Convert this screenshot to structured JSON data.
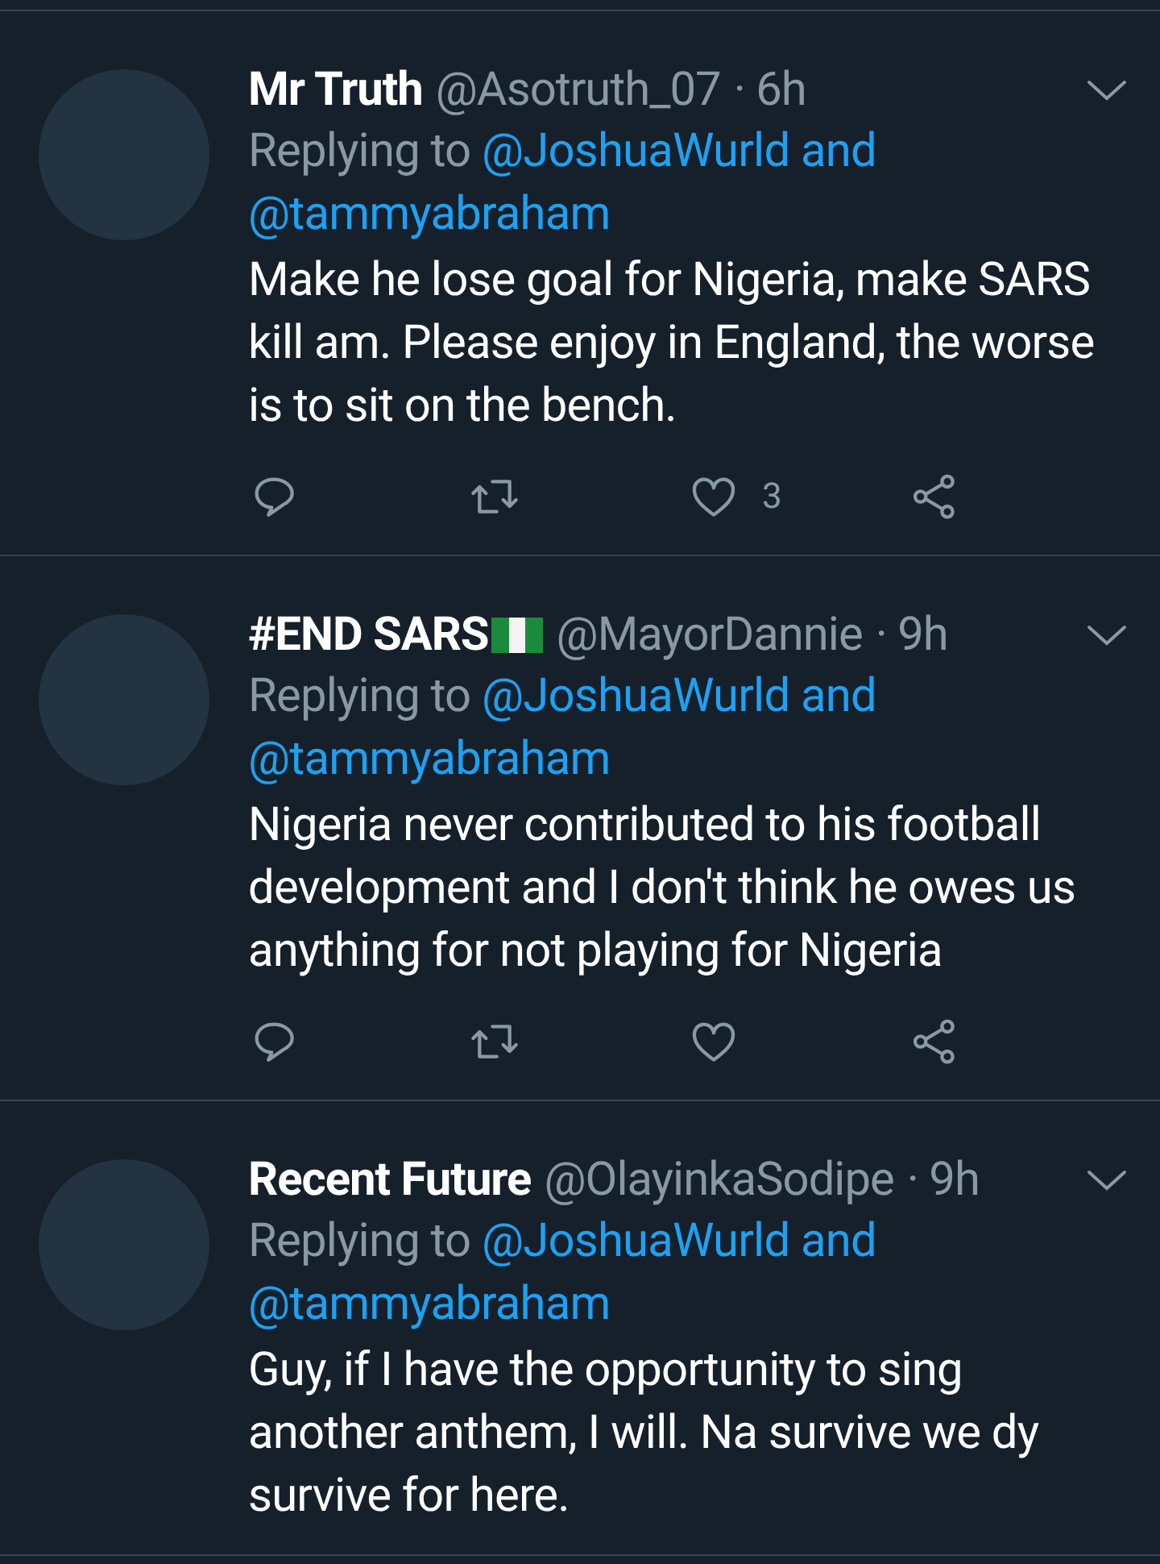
{
  "tweets": [
    {
      "name": "Mr Truth",
      "flag": false,
      "handle": "@Asotruth_07",
      "time": "· 6h",
      "replying_label": "Replying to",
      "replying_to": "@JoshuaWurld and @tammyabraham",
      "text": "Make he lose goal for Nigeria, make SARS kill am. Please enjoy in England, the worse is to sit on the bench.",
      "like_count": "3",
      "actions_visible": true
    },
    {
      "name": "#END SARS",
      "flag": true,
      "handle": "@MayorDannie",
      "time": "· 9h",
      "replying_label": "Replying to",
      "replying_to": "@JoshuaWurld and @tammyabraham",
      "text": "Nigeria never contributed to his football development and I don't think he owes us anything for not playing for Nigeria",
      "actions_visible": true
    },
    {
      "name": "Recent Future",
      "flag": false,
      "handle": "@OlayinkaSodipe",
      "time": "· 9h",
      "replying_label": "Replying to",
      "replying_to": "@JoshuaWurld and @tammyabraham",
      "text": "Guy, if I have the opportunity to sing another anthem, I will. Na survive we dy survive for here.",
      "actions_visible": false
    }
  ]
}
